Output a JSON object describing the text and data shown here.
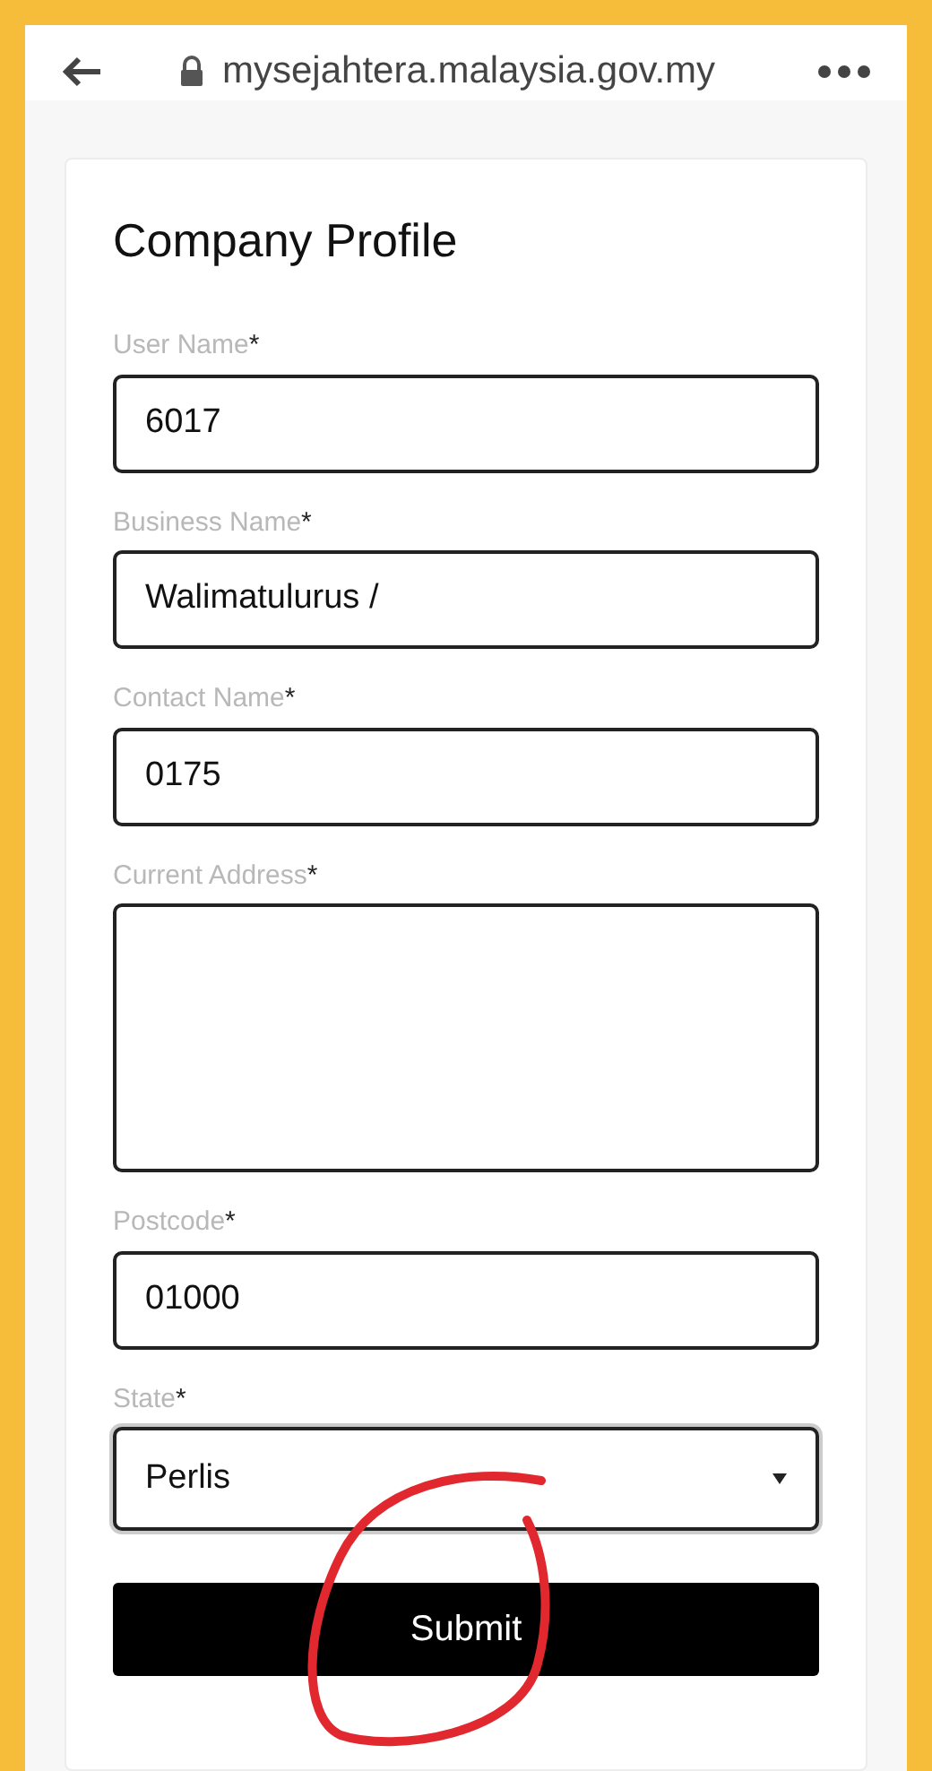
{
  "browser": {
    "url": "mysejahtera.malaysia.gov.my"
  },
  "form": {
    "title": "Company Profile",
    "fields": [
      {
        "kind": "input",
        "label": "User Name",
        "required_mark": "*",
        "value": "6017"
      },
      {
        "kind": "input",
        "label": "Business Name",
        "required_mark": "*",
        "value": "Walimatulurus /"
      },
      {
        "kind": "input",
        "label": "Contact Name",
        "required_mark": "*",
        "value": "0175"
      },
      {
        "kind": "textarea",
        "label": "Current Address",
        "required_mark": "*"
      },
      {
        "kind": "input",
        "label": "Postcode",
        "required_mark": "*",
        "value": "01000"
      },
      {
        "kind": "select",
        "label": "State",
        "required_mark": "*",
        "value": "Perlis"
      }
    ],
    "submit": "Submit"
  }
}
